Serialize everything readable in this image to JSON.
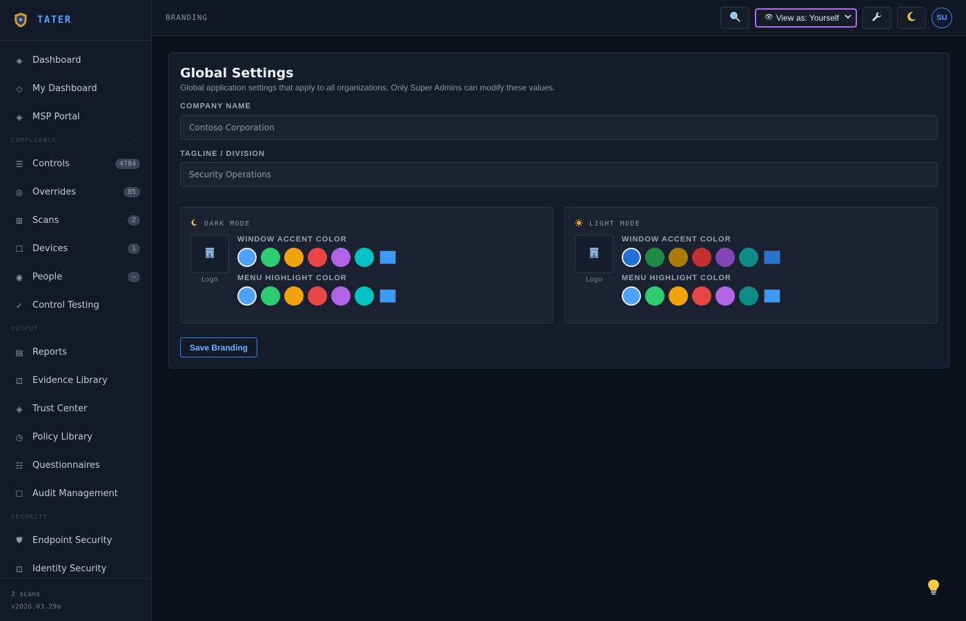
{
  "app": {
    "name": "TATER"
  },
  "sidebar": {
    "groups": [
      {
        "section": "",
        "items": [
          {
            "label": "Dashboard",
            "icon": "diamond-icon",
            "glyph": "◈",
            "badge": ""
          },
          {
            "label": "My Dashboard",
            "icon": "diamond-outline-icon",
            "glyph": "◇",
            "badge": ""
          },
          {
            "label": "MSP Portal",
            "icon": "diamond-icon",
            "glyph": "◈",
            "badge": ""
          }
        ]
      },
      {
        "section": "COMPLIANCE",
        "items": [
          {
            "label": "Controls",
            "icon": "list-icon",
            "glyph": "☰",
            "badge": "4784"
          },
          {
            "label": "Overrides",
            "icon": "target-icon",
            "glyph": "◎",
            "badge": "85"
          },
          {
            "label": "Scans",
            "icon": "grid-icon",
            "glyph": "⊞",
            "badge": "2"
          },
          {
            "label": "Devices",
            "icon": "square-icon",
            "glyph": "☐",
            "badge": "1"
          },
          {
            "label": "People",
            "icon": "person-icon",
            "glyph": "◉",
            "badge": "—"
          },
          {
            "label": "Control Testing",
            "icon": "check-icon",
            "glyph": "✓",
            "badge": ""
          }
        ]
      },
      {
        "section": "OUTPUT",
        "items": [
          {
            "label": "Reports",
            "icon": "report-icon",
            "glyph": "▤",
            "badge": ""
          },
          {
            "label": "Evidence Library",
            "icon": "evidence-icon",
            "glyph": "⊡",
            "badge": ""
          },
          {
            "label": "Trust Center",
            "icon": "diamond-icon",
            "glyph": "◈",
            "badge": ""
          },
          {
            "label": "Policy Library",
            "icon": "clock-icon",
            "glyph": "◷",
            "badge": ""
          },
          {
            "label": "Questionnaires",
            "icon": "checklist-icon",
            "glyph": "☷",
            "badge": ""
          },
          {
            "label": "Audit Management",
            "icon": "square-icon",
            "glyph": "☐",
            "badge": ""
          }
        ]
      },
      {
        "section": "SECURITY",
        "items": [
          {
            "label": "Endpoint Security",
            "icon": "shield-icon",
            "glyph": "⛊",
            "badge": ""
          },
          {
            "label": "Identity Security",
            "icon": "identity-icon",
            "glyph": "⊡",
            "badge": ""
          }
        ]
      }
    ],
    "section_dot": "·",
    "footer": {
      "scans": "2 scans",
      "version": "v2026.03.29a"
    }
  },
  "topbar": {
    "breadcrumb": "BRANDING",
    "view_as": "View as: Yourself",
    "avatar": "SU"
  },
  "main": {
    "title": "Global Settings",
    "subtitle": "Global application settings that apply to all organizations. Only Super Admins can modify these values.",
    "company_label": "COMPANY NAME",
    "company_value": "Contoso Corporation",
    "tagline_label": "TAGLINE / DIVISION",
    "tagline_value": "Security Operations",
    "save_label": "Save Branding"
  },
  "modes": [
    {
      "key": "dark",
      "label": "DARK MODE",
      "icon": "moon-icon",
      "logo_caption": "Logo",
      "accent_label": "WINDOW ACCENT COLOR",
      "menu_label": "MENU HIGHLIGHT COLOR",
      "accent_colors": [
        "#4da3ff",
        "#2ecc71",
        "#f0a30a",
        "#e84545",
        "#b165e6",
        "#00c2c2"
      ],
      "accent_custom": "#3d9af5",
      "accent_selected": 0,
      "menu_colors": [
        "#4da3ff",
        "#2ecc71",
        "#f0a30a",
        "#e84545",
        "#b165e6",
        "#00c2c2"
      ],
      "menu_custom": "#3d9af5",
      "menu_selected": 0
    },
    {
      "key": "light",
      "label": "LIGHT MODE",
      "icon": "sun-icon",
      "logo_caption": "Logo",
      "accent_label": "WINDOW ACCENT COLOR",
      "menu_label": "MENU HIGHLIGHT COLOR",
      "accent_colors": [
        "#1f6fd6",
        "#1e8a47",
        "#a87c08",
        "#c43030",
        "#8046b8",
        "#0f8c88"
      ],
      "accent_custom": "#2a73cf",
      "accent_selected": 0,
      "menu_colors": [
        "#4da3ff",
        "#2ecc71",
        "#f0a30a",
        "#e84545",
        "#b165e6",
        "#0f8c88"
      ],
      "menu_custom": "#3d9af5",
      "menu_selected": 0
    }
  ]
}
